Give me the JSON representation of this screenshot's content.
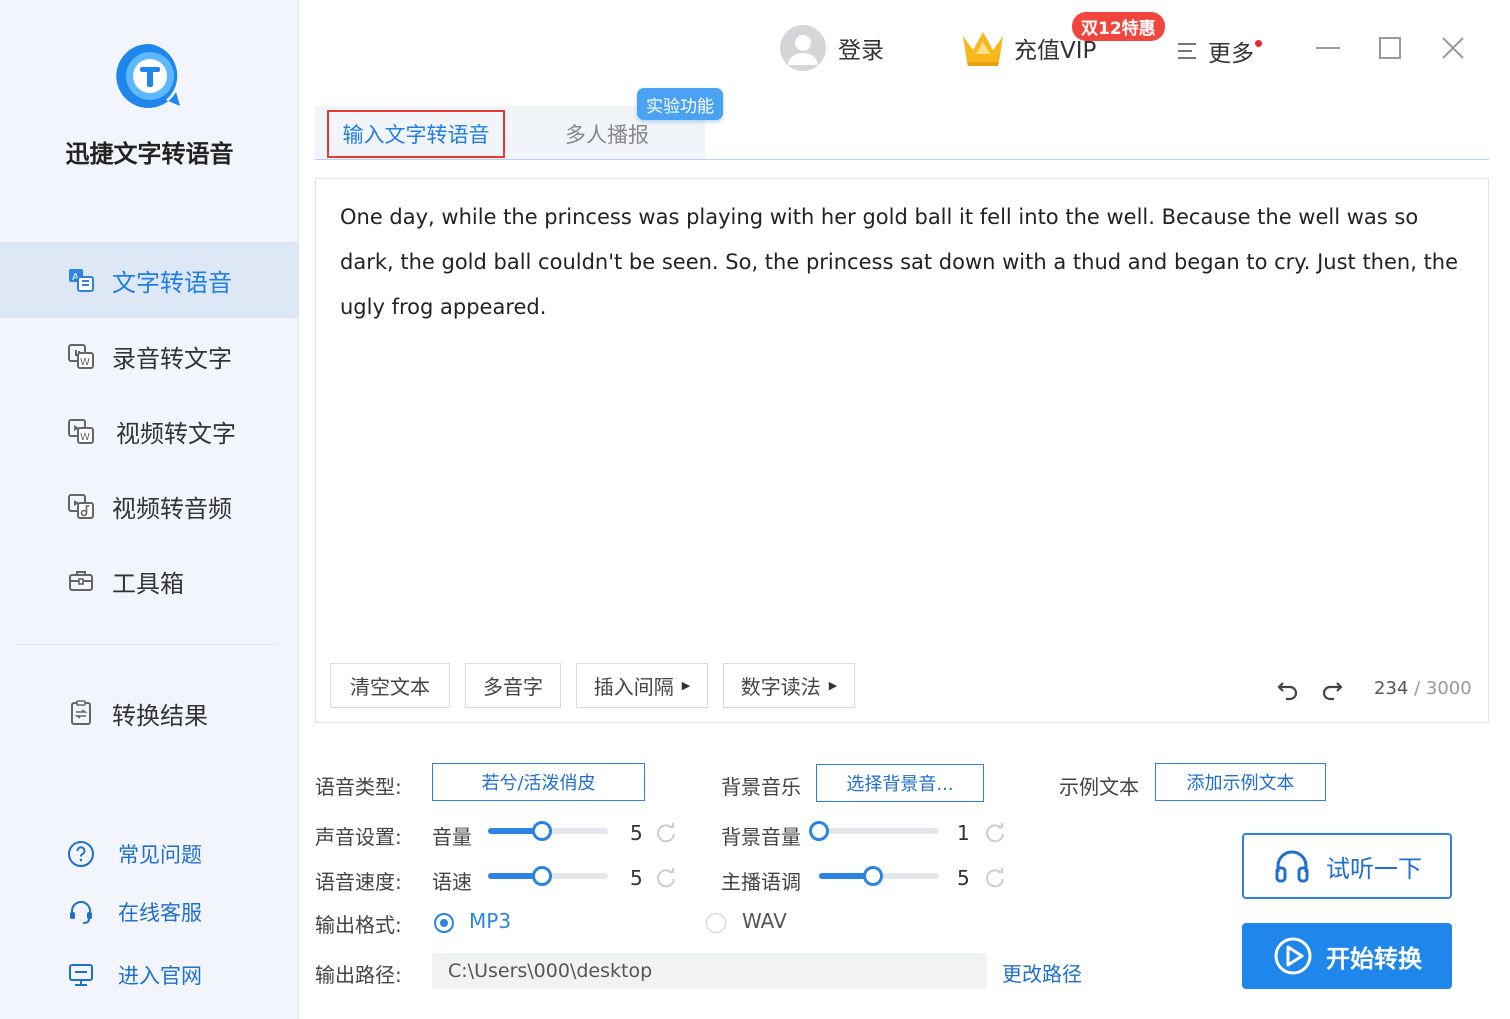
{
  "app": {
    "name": "迅捷文字转语音"
  },
  "sidebar": {
    "items": [
      {
        "label": "文字转语音",
        "icon": "text-to-speech-icon",
        "active": true
      },
      {
        "label": "录音转文字",
        "icon": "audio-to-text-icon",
        "active": false
      },
      {
        "label": "视频转文字",
        "icon": "video-to-text-icon",
        "active": false
      },
      {
        "label": "视频转音频",
        "icon": "video-to-audio-icon",
        "active": false
      },
      {
        "label": "工具箱",
        "icon": "toolbox-icon",
        "active": false
      },
      {
        "label": "转换结果",
        "icon": "results-icon",
        "active": false
      }
    ],
    "help": [
      {
        "label": "常见问题",
        "icon": "question-icon"
      },
      {
        "label": "在线客服",
        "icon": "headset-icon"
      },
      {
        "label": "进入官网",
        "icon": "monitor-icon"
      }
    ]
  },
  "titlebar": {
    "login": "登录",
    "vip": "充值VIP",
    "promo_badge": "双12特惠",
    "more": "更多"
  },
  "tabs": [
    {
      "label": "输入文字转语音",
      "active": true
    },
    {
      "label": "多人播报",
      "active": false
    }
  ],
  "experimental_badge": "实验功能",
  "editor": {
    "text": "One day, while the princess was playing with her gold ball it fell into the well. Because the well was so dark, the gold ball couldn't be seen. So, the princess sat down with a thud and began to cry. Just then, the ugly frog appeared.",
    "buttons": {
      "clear": "清空文本",
      "polyphone": "多音字",
      "insert_pause": "插入间隔",
      "number_reading": "数字读法"
    },
    "char_count": "234",
    "char_max": " / 3000"
  },
  "settings": {
    "voice_type_label": "语音类型:",
    "voice_type_value": "若兮/活泼俏皮",
    "bg_music_label": "背景音乐",
    "bg_music_button": "选择背景音...",
    "sample_text_label": "示例文本",
    "sample_text_button": "添加示例文本",
    "sound_label": "声音设置:",
    "volume_label": "音量",
    "volume_value": "5",
    "volume_fraction": 0.45,
    "bg_volume_label": "背景音量",
    "bg_volume_value": "1",
    "bg_volume_fraction": 0.0,
    "speed_row_label": "语音速度:",
    "speed_label": "语速",
    "speed_value": "5",
    "speed_fraction": 0.45,
    "pitch_label": "主播语调",
    "pitch_value": "5",
    "pitch_fraction": 0.45,
    "format_label": "输出格式:",
    "format_mp3": "MP3",
    "format_wav": "WAV",
    "format_selected": "MP3",
    "path_label": "输出路径:",
    "path_value": "C:\\Users\\000\\desktop",
    "change_path": "更改路径"
  },
  "actions": {
    "listen": "试听一下",
    "start": "开始转换"
  },
  "colors": {
    "accent": "#1f86ec",
    "promo": "#f2453d",
    "highlight_border": "#e8392e",
    "sidebar_bg": "#f2f6fc"
  }
}
